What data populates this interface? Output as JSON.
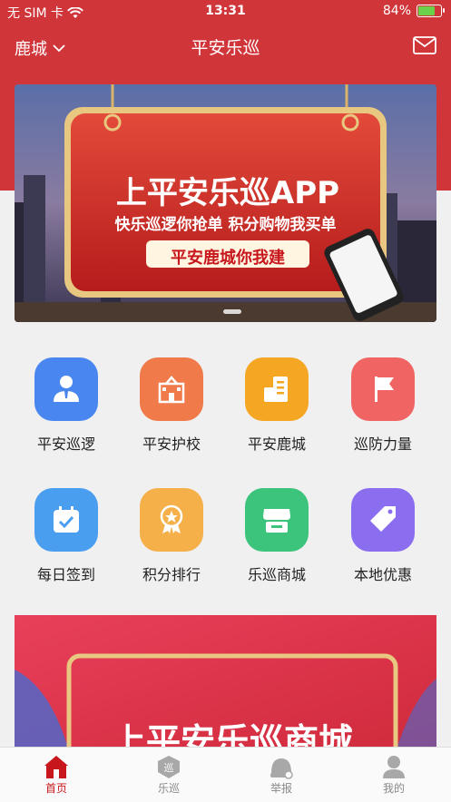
{
  "status": {
    "carrier": "无 SIM 卡",
    "time": "13:31",
    "battery": "84%",
    "battery_level": 0.84
  },
  "nav": {
    "city": "鹿城",
    "title": "平安乐巡"
  },
  "banner": {
    "headline": "上平安乐巡APP",
    "subline": "快乐巡逻你抢单  积分购物我买单",
    "tagline": "平安鹿城你我建"
  },
  "grid": [
    {
      "label": "平安巡逻",
      "icon": "patrol-person-icon",
      "color": "#4a86f0"
    },
    {
      "label": "平安护校",
      "icon": "school-icon",
      "color": "#f07a4a"
    },
    {
      "label": "平安鹿城",
      "icon": "city-building-icon",
      "color": "#f5a623"
    },
    {
      "label": "巡防力量",
      "icon": "flag-icon",
      "color": "#f06464"
    },
    {
      "label": "每日签到",
      "icon": "calendar-check-icon",
      "color": "#4a9ef0"
    },
    {
      "label": "积分排行",
      "icon": "award-icon",
      "color": "#f5b04a"
    },
    {
      "label": "乐巡商城",
      "icon": "shop-icon",
      "color": "#3cc47c"
    },
    {
      "label": "本地优惠",
      "icon": "tag-icon",
      "color": "#8b6ef0"
    }
  ],
  "promo": {
    "headline": "上平安乐巡商城"
  },
  "tabs": [
    {
      "label": "首页",
      "icon": "home-icon",
      "active": true
    },
    {
      "label": "乐巡",
      "icon": "patrol-badge-icon",
      "active": false
    },
    {
      "label": "举报",
      "icon": "report-icon",
      "active": false
    },
    {
      "label": "我的",
      "icon": "profile-icon",
      "active": false
    }
  ],
  "colors": {
    "brand": "#d0353a",
    "active_tab": "#c8161d"
  }
}
